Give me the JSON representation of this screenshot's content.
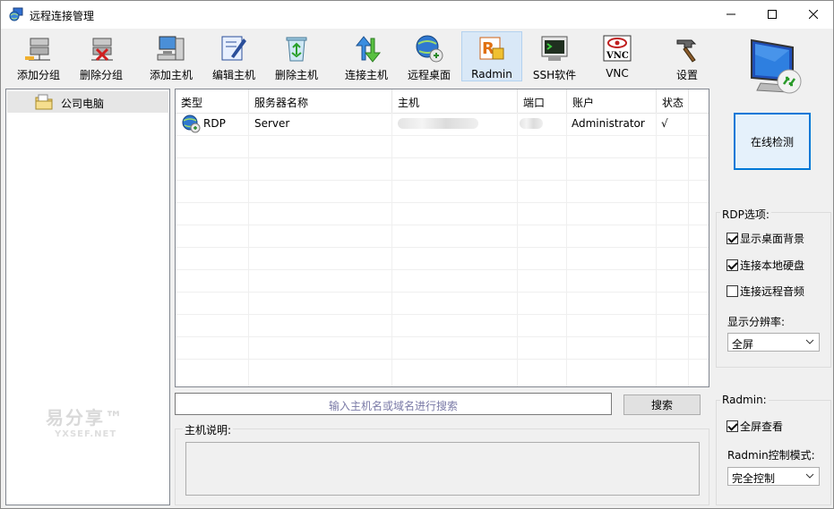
{
  "window": {
    "title": "远程连接管理"
  },
  "toolbar": [
    {
      "label": "添加分组",
      "icon": "add-group-icon"
    },
    {
      "label": "删除分组",
      "icon": "delete-group-icon"
    },
    {
      "label": "添加主机",
      "icon": "add-host-icon"
    },
    {
      "label": "编辑主机",
      "icon": "edit-host-icon"
    },
    {
      "label": "删除主机",
      "icon": "delete-host-icon"
    },
    {
      "label": "连接主机",
      "icon": "connect-host-icon"
    },
    {
      "label": "远程桌面",
      "icon": "remote-desktop-icon"
    },
    {
      "label": "Radmin",
      "icon": "radmin-icon",
      "active": true
    },
    {
      "label": "SSH软件",
      "icon": "ssh-icon"
    },
    {
      "label": "VNC",
      "icon": "vnc-icon"
    },
    {
      "label": "设置",
      "icon": "settings-icon"
    }
  ],
  "tree": {
    "items": [
      {
        "label": "公司电脑"
      }
    ]
  },
  "table": {
    "columns": [
      "类型",
      "服务器名称",
      "主机",
      "端口",
      "账户",
      "状态"
    ],
    "rows": [
      {
        "type": "RDP",
        "name": "Server",
        "host": "",
        "port": "",
        "account": "Administrator",
        "status": "√"
      }
    ]
  },
  "search": {
    "placeholder": "输入主机名或域名进行搜索",
    "button": "搜索"
  },
  "description": {
    "label": "主机说明:"
  },
  "watermark": {
    "brand": "易分享™",
    "site": "YXSEF.NET"
  },
  "online_check": {
    "label": "在线检测"
  },
  "rdp_options": {
    "title": "RDP选项:",
    "show_wallpaper": {
      "label": "显示桌面背景",
      "checked": true
    },
    "connect_local_disk": {
      "label": "连接本地硬盘",
      "checked": true
    },
    "connect_remote_audio": {
      "label": "连接远程音频",
      "checked": false
    },
    "resolution_label": "显示分辨率:",
    "resolution_value": "全屏"
  },
  "radmin_options": {
    "title": "Radmin:",
    "fullscreen_view": {
      "label": "全屏查看",
      "checked": true
    },
    "control_mode_label": "Radmin控制模式:",
    "control_mode_value": "完全控制"
  },
  "colors": {
    "accent": "#0078d7",
    "selected_toolbar": "#d9e8f7"
  }
}
